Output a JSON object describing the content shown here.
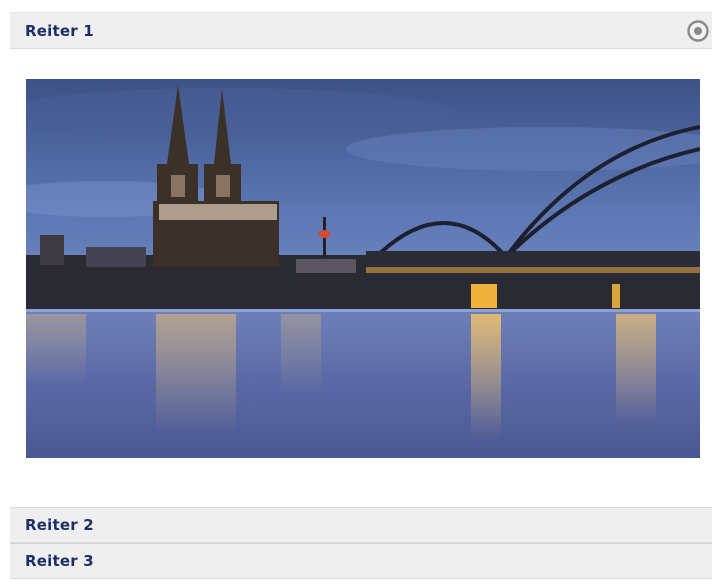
{
  "accordion": {
    "tabs": [
      {
        "label": "Reiter 1",
        "expanded": true
      },
      {
        "label": "Reiter 2",
        "expanded": false
      },
      {
        "label": "Reiter 3",
        "expanded": false
      }
    ],
    "icon": "target-icon"
  }
}
